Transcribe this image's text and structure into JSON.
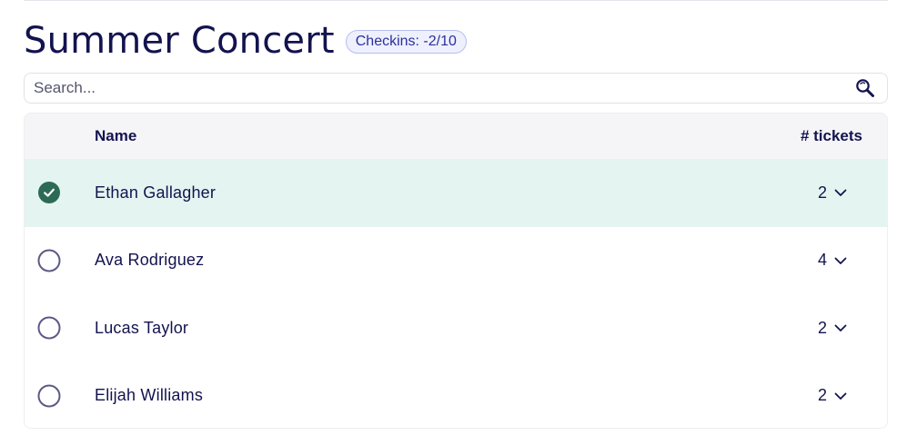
{
  "event": {
    "title": "Summer Concert",
    "checkins_label": "Checkins: -2/10"
  },
  "search": {
    "placeholder": "Search...",
    "icon": "search-icon"
  },
  "table": {
    "columns": {
      "name": "Name",
      "tickets": "# tickets"
    },
    "rows": [
      {
        "name": "Ethan Gallagher",
        "tickets": "2",
        "checked_in": true
      },
      {
        "name": "Ava Rodriguez",
        "tickets": "4",
        "checked_in": false
      },
      {
        "name": "Lucas Taylor",
        "tickets": "2",
        "checked_in": false
      },
      {
        "name": "Elijah Williams",
        "tickets": "2",
        "checked_in": false
      }
    ]
  },
  "colors": {
    "text": "#13134f",
    "checked": "#2d6a55",
    "checked_row": "#e4f5f1",
    "unchecked_ring": "#5d5a85",
    "badge_bg": "#eef0fd",
    "badge_border": "#b9bdf0"
  }
}
